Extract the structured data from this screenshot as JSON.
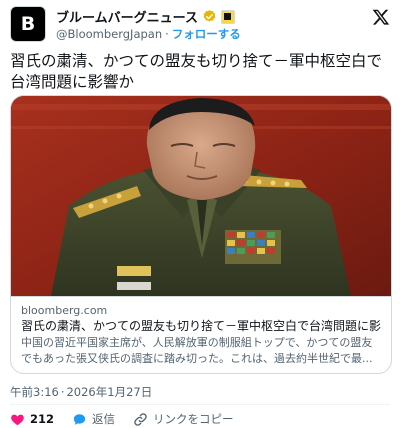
{
  "account": {
    "avatar_letter": "B",
    "display_name": "ブルームバーグニュース",
    "handle": "@BloombergJapan",
    "separator": "·",
    "follow_label": "フォローする"
  },
  "tweet": {
    "text": "習氏の粛清、かつての盟友も切り捨て－軍中枢空白で台湾問題に影響か"
  },
  "card": {
    "domain": "bloomberg.com",
    "title": "習氏の粛清、かつての盟友も切り捨て－軍中枢空白で台湾問題に影響か",
    "description": "中国の習近平国家主席が、人民解放軍の制服組トップで、かつての盟友でもあった張又侠氏の調査に踏み切った。これは、過去約半世紀で最..."
  },
  "timestamp": {
    "time": "午前3:16",
    "separator": "·",
    "date": "2026年1月27日"
  },
  "actions": {
    "like_count": "212",
    "reply_label": "返信",
    "copy_link_label": "リンクをコピー"
  },
  "colors": {
    "accent": "#1d9bf0",
    "like": "#f91880",
    "verified_badge": "#e8b500",
    "text_primary": "#0f1419",
    "text_secondary": "#536471"
  },
  "icons": {
    "verified": "verified-badge-icon",
    "affiliate": "affiliate-badge-icon",
    "platform": "x-logo-icon",
    "like": "heart-icon",
    "reply": "reply-bubble-icon",
    "copy_link": "link-icon"
  }
}
